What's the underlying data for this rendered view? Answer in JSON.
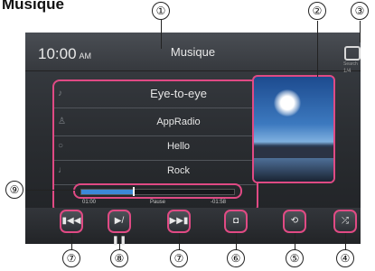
{
  "heading": "Musique",
  "screen": {
    "time": "10:00",
    "ampm": "AM",
    "title": "Musique",
    "search_label": "Search",
    "track_number": "1/4"
  },
  "track": {
    "song": "Eye-to-eye",
    "artist": "AppRadio",
    "album": "Hello",
    "genre": "Rock"
  },
  "icons": {
    "song": "music-note-icon",
    "artist": "person-icon",
    "album": "disc-icon",
    "genre": "guitar-icon"
  },
  "progress": {
    "elapsed": "01:00",
    "state": "Pause",
    "remaining": "-01:58",
    "fraction": 0.34
  },
  "controls": [
    {
      "name": "previous-track-button",
      "glyph": "▮◀◀"
    },
    {
      "name": "play-pause-button",
      "glyph": "▶/❚❚"
    },
    {
      "name": "next-track-button",
      "glyph": "▶▶▮"
    },
    {
      "name": "display-mode-button",
      "glyph": "◘"
    },
    {
      "name": "repeat-button",
      "glyph": "⟲"
    },
    {
      "name": "shuffle-button",
      "glyph": "⤮"
    }
  ],
  "callouts": {
    "c1": "①",
    "c2": "②",
    "c3": "③",
    "c4": "④",
    "c5": "⑤",
    "c6": "⑥",
    "c7a": "⑦",
    "c7b": "⑦",
    "c8": "⑧",
    "c9": "⑨"
  },
  "colors": {
    "highlight": "#e04a84",
    "progress_fill": "#3c88d8"
  }
}
